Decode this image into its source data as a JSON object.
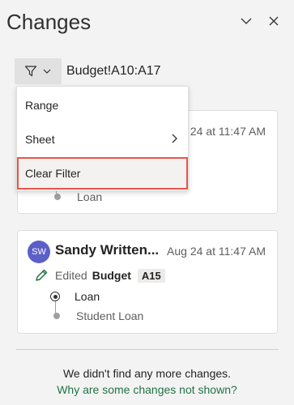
{
  "pane": {
    "title": "Changes"
  },
  "filter": {
    "range": "Budget!A10:A17"
  },
  "menu": {
    "items": [
      "Range",
      "Sheet",
      "Clear Filter"
    ]
  },
  "card1": {
    "time": "24 at 11:47 AM",
    "old_value": "Loan"
  },
  "card2": {
    "avatar": "SW",
    "author": "Sandy Written...",
    "time": "Aug 24 at 11:47 AM",
    "action": "Edited",
    "sheet": "Budget",
    "cell": "A15",
    "new_value": "Loan",
    "old_value": "Student Loan"
  },
  "footer": {
    "message": "We didn't find any more changes.",
    "link": "Why are some changes not shown?"
  },
  "colors": {
    "accent": "#217346",
    "avatar": "#5b5fc7",
    "highlight": "#e8554a"
  }
}
